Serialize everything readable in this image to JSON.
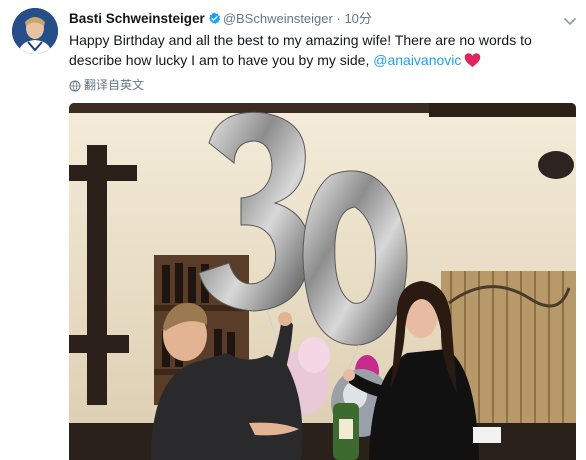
{
  "tweet": {
    "display_name": "Basti Schweinsteiger",
    "handle": "@BSchweinsteiger",
    "separator": "·",
    "time": "10分",
    "text_main": "Happy Birthday and all the best to my amazing wife! There are no words to describe how lucky I am to have you by my side,",
    "mention": "@anaivanovic",
    "translate_label": "翻译自英文"
  },
  "icons": {
    "verified": "verified-badge-icon",
    "caret": "chevron-down-icon",
    "heart": "red-heart-emoji-icon",
    "globe": "globe-icon"
  },
  "photo": {
    "balloon_digits": [
      "3",
      "0"
    ]
  },
  "colors": {
    "link": "#1da1f2",
    "secondary_text": "#657786",
    "verified": "#1da1f2",
    "heart": "#e0245e"
  }
}
